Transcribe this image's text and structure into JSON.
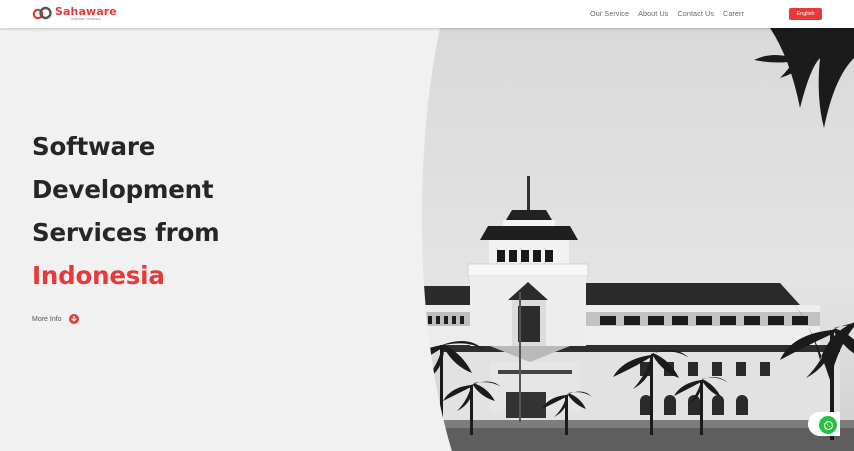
{
  "brand": {
    "name": "Sahaware",
    "tagline": "Software Company",
    "accent_color": "#e63a3a"
  },
  "nav": {
    "items": [
      {
        "label": "Our Service"
      },
      {
        "label": "About Us"
      },
      {
        "label": "Contact Us"
      },
      {
        "label": "Carerr"
      }
    ],
    "language_button": "English"
  },
  "hero": {
    "lines": [
      "Software",
      "Development",
      "Services from"
    ],
    "accent_line": "Indonesia",
    "more_info_label": "More Info",
    "more_info_icon": "arrow-down-circle-icon"
  },
  "image": {
    "subject": "gedung-sate-building",
    "style": "black-and-white"
  },
  "floating": {
    "whatsapp_icon": "whatsapp-icon",
    "whatsapp_color": "#25c03f"
  }
}
